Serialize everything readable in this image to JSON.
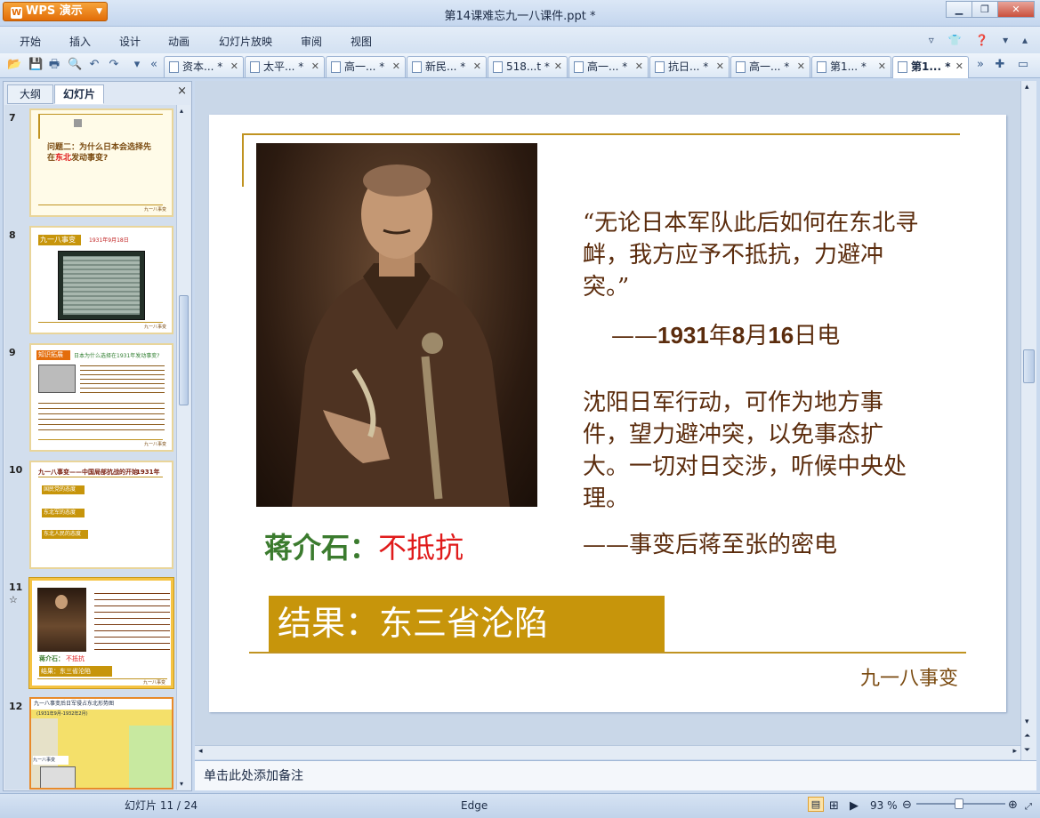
{
  "app": {
    "name": "WPS 演示",
    "title": "第14课难忘九一八课件.ppt *"
  },
  "menu": [
    "开始",
    "插入",
    "设计",
    "动画",
    "幻灯片放映",
    "审阅",
    "视图"
  ],
  "tabs": [
    "资本... *",
    "太平... *",
    "高一... *",
    "新民... *",
    "518...t *",
    "高一... *",
    "抗日... *",
    "高一... *",
    "第1... *",
    "第1... *"
  ],
  "panel": {
    "tab_outline": "大纲",
    "tab_slides": "幻灯片",
    "close": "×"
  },
  "thumbs": [
    {
      "num": "7",
      "title": "问题二：为什么日本会选择先在东北发动事变?",
      "highlight": "东北",
      "footer": "九一八事变"
    },
    {
      "num": "8",
      "title": "九一八事变",
      "date": "1931年9月18日",
      "footer": "九一八事变"
    },
    {
      "num": "9",
      "label": "知识拓展",
      "title": "日本为什么选择在1931年发动事变?",
      "footer": "九一八事变"
    },
    {
      "num": "10",
      "title": "九一八事变——中国局部抗战的开始",
      "year": "1931年",
      "items": [
        "国民党的态度",
        "东北军的态度",
        "东北人民的态度"
      ]
    },
    {
      "num": "11",
      "star": "☆",
      "name": "蒋介石：",
      "attitude": "不抵抗",
      "result": "结果：东三省沦陷",
      "footer": "九一八事变"
    },
    {
      "num": "12",
      "title": "九一八事变后日军侵占东北形势图",
      "subtitle": "(1931年9月-1932年2月)",
      "label": "九一八事变"
    }
  ],
  "slide": {
    "quote1": "“无论日本军队此后如何在东北寻衅，我方应予不抵抗，力避冲突。”",
    "src1_dash": "——",
    "src1_year": "1931",
    "src1_year_suffix": "年",
    "src1_month": "8",
    "src1_month_suffix": "月",
    "src1_day": "16",
    "src1_day_suffix": "日电",
    "quote2": "沈阳日军行动，可作为地方事件，望力避冲突，以免事态扩大。一切对日交涉，听候中央处理。",
    "src2": "——事变后蒋至张的密电",
    "name": "蒋介石：",
    "attitude": "不抵抗",
    "result": "结果：东三省沦陷",
    "footer": "九一八事变"
  },
  "notes_placeholder": "单击此处添加备注",
  "status": {
    "slide_info": "幻灯片 11 / 24",
    "theme": "Edge",
    "zoom": "93 %"
  },
  "colors": {
    "accent": "#c09321",
    "quote_text": "#5b2c0d",
    "name_green": "#3b7b2e",
    "attitude_red": "#e01b1b",
    "result_bg": "#c7950b"
  }
}
